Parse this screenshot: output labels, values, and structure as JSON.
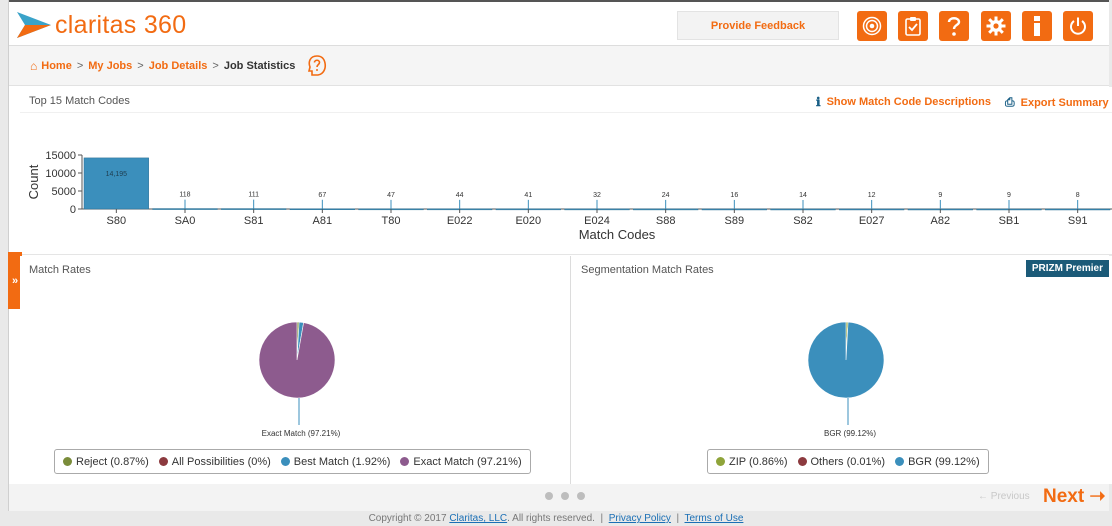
{
  "brand": {
    "logo_text": "claritas 360"
  },
  "header": {
    "feedback_label": "Provide Feedback",
    "icons": [
      "target-icon",
      "clipboard-icon",
      "help-icon",
      "gear-icon",
      "info-icon",
      "power-icon"
    ],
    "accent": "#f26b12"
  },
  "breadcrumb": {
    "home": "Home",
    "sep": ">",
    "my_jobs": "My Jobs",
    "job_details": "Job Details",
    "current": "Job Statistics"
  },
  "top_panel": {
    "title": "Top 15 Match Codes",
    "show_desc": "Show Match Code Descriptions",
    "export": "Export Summary"
  },
  "match_rates": {
    "title": "Match Rates",
    "legend": [
      {
        "label": "Reject (0.87%)",
        "color": "#7a8c3a"
      },
      {
        "label": "All Possibilities (0%)",
        "color": "#8c3a3f"
      },
      {
        "label": "Best Match (1.92%)",
        "color": "#3b8fbc"
      },
      {
        "label": "Exact Match (97.21%)",
        "color": "#8d5b8e"
      }
    ]
  },
  "segmentation": {
    "title": "Segmentation Match Rates",
    "badge": "PRIZM Premier",
    "legend": [
      {
        "label": "ZIP (0.86%)",
        "color": "#8fa43a"
      },
      {
        "label": "Others (0.01%)",
        "color": "#8c3a3f"
      },
      {
        "label": "BGR (99.12%)",
        "color": "#3b8fbc"
      }
    ]
  },
  "pager": {
    "previous": "← Previous",
    "next": "Next"
  },
  "footer": {
    "copyright": "Copyright © 2017",
    "company": "Claritas, LLC",
    "rights": ". All rights reserved.",
    "sep": "|",
    "privacy": "Privacy Policy",
    "terms": "Terms of Use"
  },
  "chart_data": [
    {
      "type": "bar",
      "categories": [
        "S80",
        "SA0",
        "S81",
        "A81",
        "T80",
        "E022",
        "E020",
        "E024",
        "S88",
        "S89",
        "S82",
        "E027",
        "A82",
        "SB1",
        "S91"
      ],
      "values": [
        14195,
        118,
        111,
        67,
        47,
        44,
        41,
        32,
        24,
        16,
        14,
        12,
        9,
        9,
        8
      ],
      "title": "",
      "xlabel": "Match Codes",
      "ylabel": "Count",
      "ylim": [
        0,
        15000
      ],
      "yticks": [
        0,
        5000,
        10000,
        15000
      ],
      "data_labels": [
        "14,195",
        "118",
        "111",
        "67",
        "47",
        "44",
        "41",
        "32",
        "24",
        "16",
        "14",
        "12",
        "9",
        "9",
        "8"
      ],
      "color": "#3b8fbc"
    },
    {
      "type": "pie",
      "labels": [
        "Reject",
        "All Possibilities",
        "Best Match",
        "Exact Match"
      ],
      "values": [
        0.87,
        0,
        1.92,
        97.21
      ],
      "colors": [
        "#7a8c3a",
        "#8c3a3f",
        "#3b8fbc",
        "#8d5b8e"
      ],
      "callout": "Exact Match (97.21%)"
    },
    {
      "type": "pie",
      "labels": [
        "ZIP",
        "Others",
        "BGR"
      ],
      "values": [
        0.86,
        0.01,
        99.12
      ],
      "colors": [
        "#8fa43a",
        "#8c3a3f",
        "#3b8fbc"
      ],
      "callout": "BGR (99.12%)"
    }
  ]
}
